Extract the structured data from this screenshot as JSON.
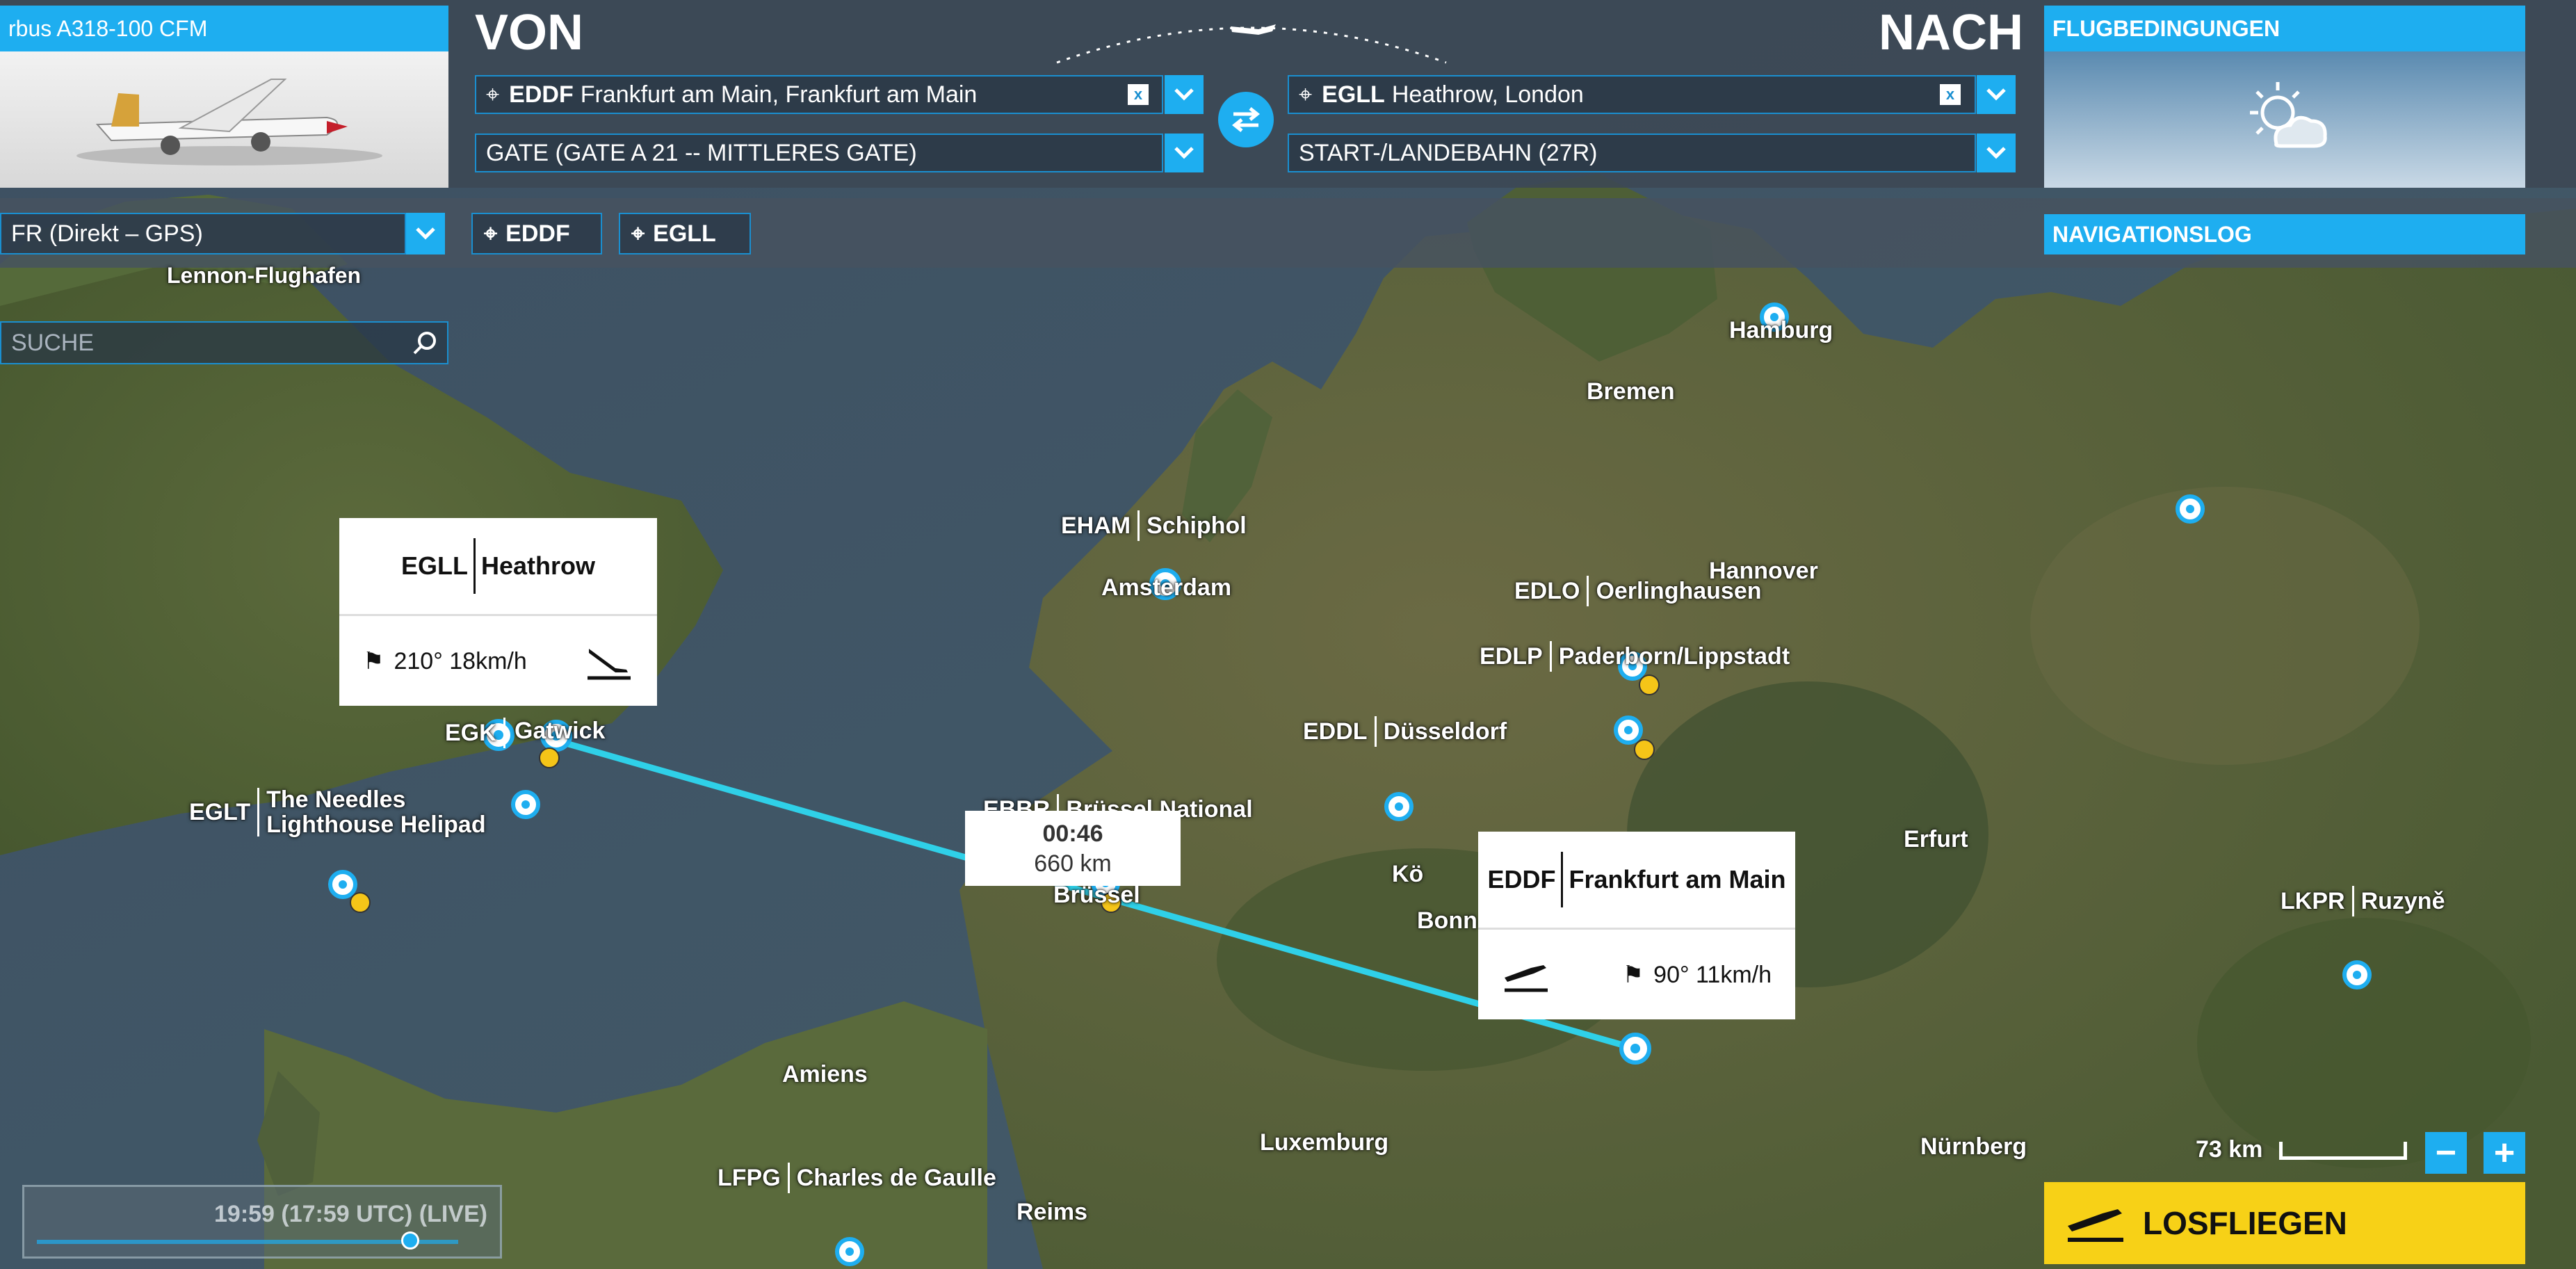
{
  "aircraft": {
    "name": "rbus A318-100 CFM"
  },
  "departure": {
    "heading": "VON",
    "airport_code": "EDDF",
    "airport_name": "Frankfurt am Main, Frankfurt am Main",
    "clear_label": "x",
    "gate": "GATE (GATE A 21 -- MITTLERES GATE)"
  },
  "arrival": {
    "heading": "NACH",
    "airport_code": "EGLL",
    "airport_name": "Heathrow, London",
    "clear_label": "x",
    "runway": "START-/LANDEBAHN (27R)"
  },
  "conditions": {
    "label": "FLUGBEDINGUNGEN"
  },
  "route": {
    "flight_type": "FR (Direkt – GPS)",
    "chips": [
      "EDDF",
      "EGLL"
    ],
    "navlog_label": "NAVIGATIONSLOG"
  },
  "search": {
    "placeholder": "SUCHE"
  },
  "map_labels": {
    "lennon": "Lennon-Flughafen",
    "hamburg": "Hamburg",
    "bremen": "Bremen",
    "hannover": "Hannover",
    "amsterdam": "Amsterdam",
    "bonn": "Bonn",
    "koeln": "Kö",
    "erfurt": "Erfurt",
    "amiens": "Amiens",
    "luxemburg": "Luxemburg",
    "nuernberg": "Nürnberg",
    "reims": "Reims",
    "bruessel": "Brüssel",
    "gatwick": "Gatwick"
  },
  "airports": [
    {
      "code": "EHAM",
      "name": "Schiphol"
    },
    {
      "code": "EDLO",
      "name": "Oerlinghausen"
    },
    {
      "code": "EDLP",
      "name": "Paderborn/Lippstadt"
    },
    {
      "code": "EDDL",
      "name": "Düsseldorf"
    },
    {
      "code": "EBBR",
      "name": "Brüssel National"
    },
    {
      "code": "EGLT",
      "name": "The Needles\nLighthouse Helipad"
    },
    {
      "code": "LKPR",
      "name": "Ruzyně"
    },
    {
      "code": "LFPG",
      "name": "Charles de Gaulle"
    },
    {
      "code": "EGK",
      "name": ""
    }
  ],
  "popup_arrival": {
    "code": "EGLL",
    "name": "Heathrow",
    "wind": "210° 18km/h"
  },
  "popup_departure": {
    "code": "EDDF",
    "name": "Frankfurt am Main",
    "wind": "90° 11km/h"
  },
  "route_info": {
    "time": "00:46",
    "distance": "660 km"
  },
  "time_bar": {
    "text": "19:59 (17:59 UTC) (LIVE)"
  },
  "scale": {
    "label": "73 km",
    "zoom_out": "−",
    "zoom_in": "+"
  },
  "fly_button": {
    "label": "LOSFLIEGEN"
  },
  "colors": {
    "accent": "#1eaef0",
    "route": "#2fd0e8",
    "go_button": "#f7d117"
  }
}
